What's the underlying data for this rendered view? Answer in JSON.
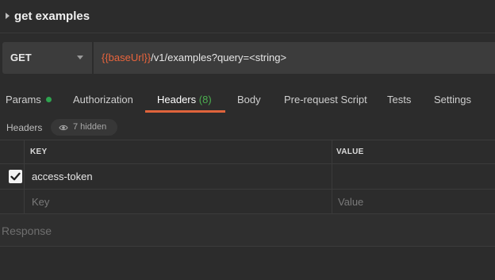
{
  "request": {
    "name": "get examples",
    "method": "GET",
    "url": {
      "variable": "{{baseUrl}}",
      "path": "/v1/examples?query=<string>"
    }
  },
  "tabs": [
    {
      "label": "Params",
      "status": "green-dot"
    },
    {
      "label": "Authorization"
    },
    {
      "label": "Headers",
      "count": "(8)",
      "active": true
    },
    {
      "label": "Body"
    },
    {
      "label": "Pre-request Script"
    },
    {
      "label": "Tests"
    },
    {
      "label": "Settings"
    }
  ],
  "headers_panel": {
    "label": "Headers",
    "hidden_label": "7 hidden"
  },
  "table": {
    "columns": [
      "KEY",
      "VALUE"
    ],
    "rows": [
      {
        "checked": true,
        "key": "access-token",
        "value": ""
      }
    ],
    "new_row": {
      "key_placeholder": "Key",
      "value_placeholder": "Value"
    }
  },
  "response": {
    "label": "Response"
  },
  "colors": {
    "accent": "#e0643c",
    "variable": "#e8643c",
    "count_green": "#4caf50",
    "dot_green": "#2ea44f"
  }
}
